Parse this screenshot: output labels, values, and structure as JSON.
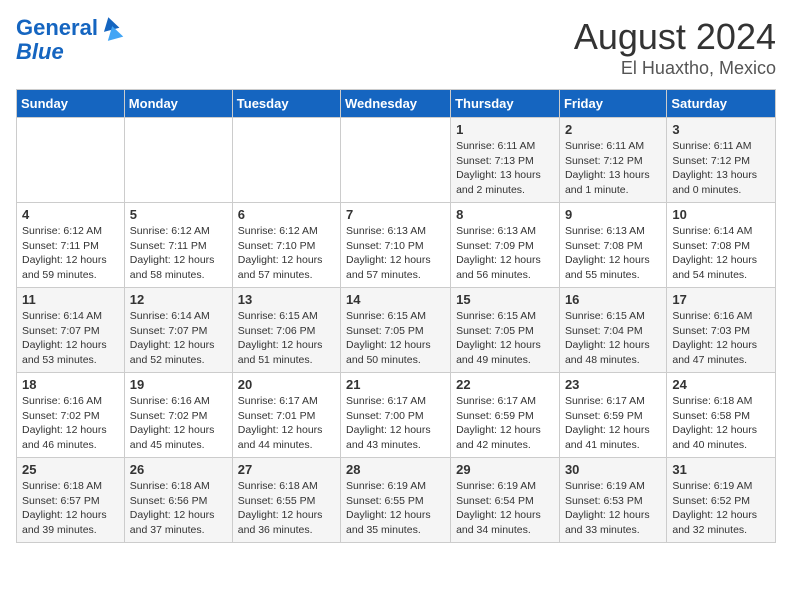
{
  "header": {
    "logo_line1": "General",
    "logo_line2": "Blue",
    "month": "August 2024",
    "location": "El Huaxtho, Mexico"
  },
  "calendar": {
    "days_of_week": [
      "Sunday",
      "Monday",
      "Tuesday",
      "Wednesday",
      "Thursday",
      "Friday",
      "Saturday"
    ],
    "weeks": [
      [
        {
          "day": "",
          "detail": ""
        },
        {
          "day": "",
          "detail": ""
        },
        {
          "day": "",
          "detail": ""
        },
        {
          "day": "",
          "detail": ""
        },
        {
          "day": "1",
          "detail": "Sunrise: 6:11 AM\nSunset: 7:13 PM\nDaylight: 13 hours\nand 2 minutes."
        },
        {
          "day": "2",
          "detail": "Sunrise: 6:11 AM\nSunset: 7:12 PM\nDaylight: 13 hours\nand 1 minute."
        },
        {
          "day": "3",
          "detail": "Sunrise: 6:11 AM\nSunset: 7:12 PM\nDaylight: 13 hours\nand 0 minutes."
        }
      ],
      [
        {
          "day": "4",
          "detail": "Sunrise: 6:12 AM\nSunset: 7:11 PM\nDaylight: 12 hours\nand 59 minutes."
        },
        {
          "day": "5",
          "detail": "Sunrise: 6:12 AM\nSunset: 7:11 PM\nDaylight: 12 hours\nand 58 minutes."
        },
        {
          "day": "6",
          "detail": "Sunrise: 6:12 AM\nSunset: 7:10 PM\nDaylight: 12 hours\nand 57 minutes."
        },
        {
          "day": "7",
          "detail": "Sunrise: 6:13 AM\nSunset: 7:10 PM\nDaylight: 12 hours\nand 57 minutes."
        },
        {
          "day": "8",
          "detail": "Sunrise: 6:13 AM\nSunset: 7:09 PM\nDaylight: 12 hours\nand 56 minutes."
        },
        {
          "day": "9",
          "detail": "Sunrise: 6:13 AM\nSunset: 7:08 PM\nDaylight: 12 hours\nand 55 minutes."
        },
        {
          "day": "10",
          "detail": "Sunrise: 6:14 AM\nSunset: 7:08 PM\nDaylight: 12 hours\nand 54 minutes."
        }
      ],
      [
        {
          "day": "11",
          "detail": "Sunrise: 6:14 AM\nSunset: 7:07 PM\nDaylight: 12 hours\nand 53 minutes."
        },
        {
          "day": "12",
          "detail": "Sunrise: 6:14 AM\nSunset: 7:07 PM\nDaylight: 12 hours\nand 52 minutes."
        },
        {
          "day": "13",
          "detail": "Sunrise: 6:15 AM\nSunset: 7:06 PM\nDaylight: 12 hours\nand 51 minutes."
        },
        {
          "day": "14",
          "detail": "Sunrise: 6:15 AM\nSunset: 7:05 PM\nDaylight: 12 hours\nand 50 minutes."
        },
        {
          "day": "15",
          "detail": "Sunrise: 6:15 AM\nSunset: 7:05 PM\nDaylight: 12 hours\nand 49 minutes."
        },
        {
          "day": "16",
          "detail": "Sunrise: 6:15 AM\nSunset: 7:04 PM\nDaylight: 12 hours\nand 48 minutes."
        },
        {
          "day": "17",
          "detail": "Sunrise: 6:16 AM\nSunset: 7:03 PM\nDaylight: 12 hours\nand 47 minutes."
        }
      ],
      [
        {
          "day": "18",
          "detail": "Sunrise: 6:16 AM\nSunset: 7:02 PM\nDaylight: 12 hours\nand 46 minutes."
        },
        {
          "day": "19",
          "detail": "Sunrise: 6:16 AM\nSunset: 7:02 PM\nDaylight: 12 hours\nand 45 minutes."
        },
        {
          "day": "20",
          "detail": "Sunrise: 6:17 AM\nSunset: 7:01 PM\nDaylight: 12 hours\nand 44 minutes."
        },
        {
          "day": "21",
          "detail": "Sunrise: 6:17 AM\nSunset: 7:00 PM\nDaylight: 12 hours\nand 43 minutes."
        },
        {
          "day": "22",
          "detail": "Sunrise: 6:17 AM\nSunset: 6:59 PM\nDaylight: 12 hours\nand 42 minutes."
        },
        {
          "day": "23",
          "detail": "Sunrise: 6:17 AM\nSunset: 6:59 PM\nDaylight: 12 hours\nand 41 minutes."
        },
        {
          "day": "24",
          "detail": "Sunrise: 6:18 AM\nSunset: 6:58 PM\nDaylight: 12 hours\nand 40 minutes."
        }
      ],
      [
        {
          "day": "25",
          "detail": "Sunrise: 6:18 AM\nSunset: 6:57 PM\nDaylight: 12 hours\nand 39 minutes."
        },
        {
          "day": "26",
          "detail": "Sunrise: 6:18 AM\nSunset: 6:56 PM\nDaylight: 12 hours\nand 37 minutes."
        },
        {
          "day": "27",
          "detail": "Sunrise: 6:18 AM\nSunset: 6:55 PM\nDaylight: 12 hours\nand 36 minutes."
        },
        {
          "day": "28",
          "detail": "Sunrise: 6:19 AM\nSunset: 6:55 PM\nDaylight: 12 hours\nand 35 minutes."
        },
        {
          "day": "29",
          "detail": "Sunrise: 6:19 AM\nSunset: 6:54 PM\nDaylight: 12 hours\nand 34 minutes."
        },
        {
          "day": "30",
          "detail": "Sunrise: 6:19 AM\nSunset: 6:53 PM\nDaylight: 12 hours\nand 33 minutes."
        },
        {
          "day": "31",
          "detail": "Sunrise: 6:19 AM\nSunset: 6:52 PM\nDaylight: 12 hours\nand 32 minutes."
        }
      ]
    ]
  }
}
